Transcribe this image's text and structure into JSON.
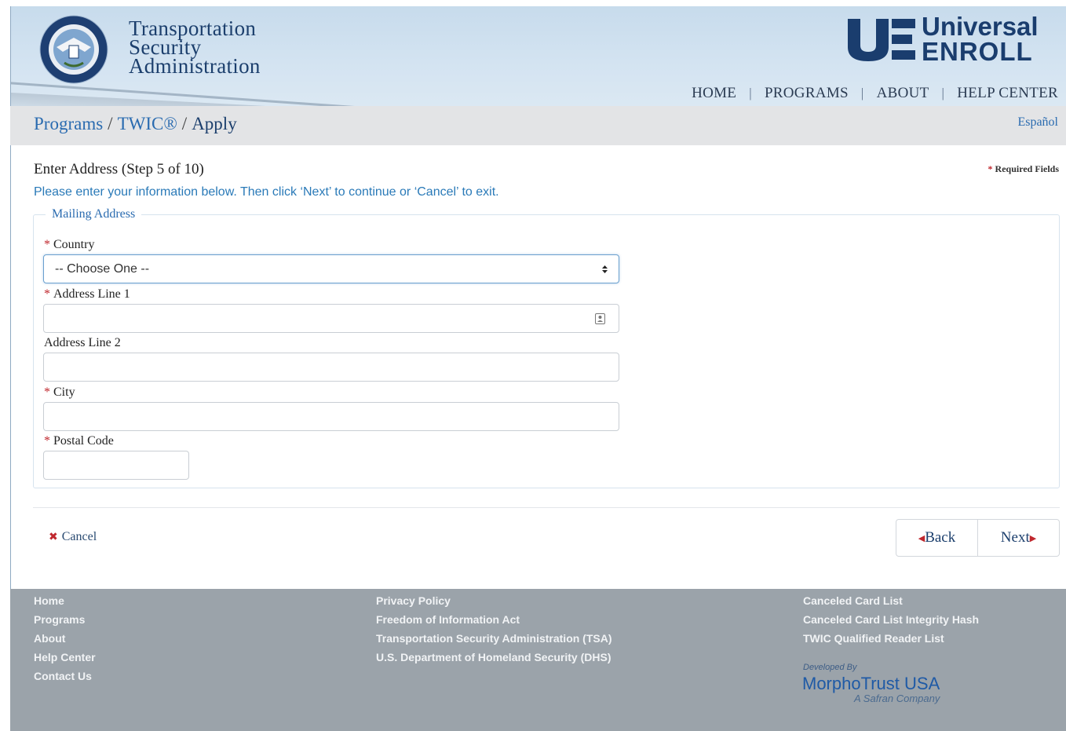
{
  "header": {
    "agency_lines": [
      "Transportation",
      "Security",
      "Administration"
    ],
    "brand_line1": "Universal",
    "brand_line2": "ENROLL",
    "nav": [
      "HOME",
      "PROGRAMS",
      "ABOUT",
      "HELP CENTER"
    ]
  },
  "breadcrumb": {
    "items": [
      "Programs",
      "TWIC®"
    ],
    "current": "Apply",
    "language_link": "Español"
  },
  "form": {
    "step_title": "Enter Address (Step 5 of 10)",
    "required_note": "Required Fields",
    "instructions": "Please enter your information below. Then click ‘Next’ to continue or ‘Cancel’ to exit.",
    "section_legend": "Mailing Address",
    "fields": {
      "country": {
        "label": "Country",
        "value": "-- Choose One --"
      },
      "address1": {
        "label": "Address Line 1",
        "value": ""
      },
      "address2": {
        "label": "Address Line 2",
        "value": ""
      },
      "city": {
        "label": "City",
        "value": ""
      },
      "postal": {
        "label": "Postal Code",
        "value": ""
      }
    },
    "cancel_label": "Cancel",
    "back_label": "Back",
    "next_label": "Next"
  },
  "footer": {
    "col1": [
      "Home",
      "Programs",
      "About",
      "Help Center",
      "Contact Us"
    ],
    "col2": [
      "Privacy Policy",
      "Freedom of Information Act",
      "Transportation Security Administration (TSA)",
      "U.S. Department of Homeland Security (DHS)"
    ],
    "col3": [
      "Canceled Card List",
      "Canceled Card List Integrity Hash",
      "TWIC Qualified Reader List"
    ],
    "developed_by": "Developed By",
    "developer": "MorphoTrust USA",
    "developer_tagline": "A Safran Company"
  },
  "colors": {
    "link_blue": "#2a6bb0",
    "navy": "#1c3f6d",
    "required_red": "#c0282e",
    "footer_gray": "#9ba3aa"
  }
}
